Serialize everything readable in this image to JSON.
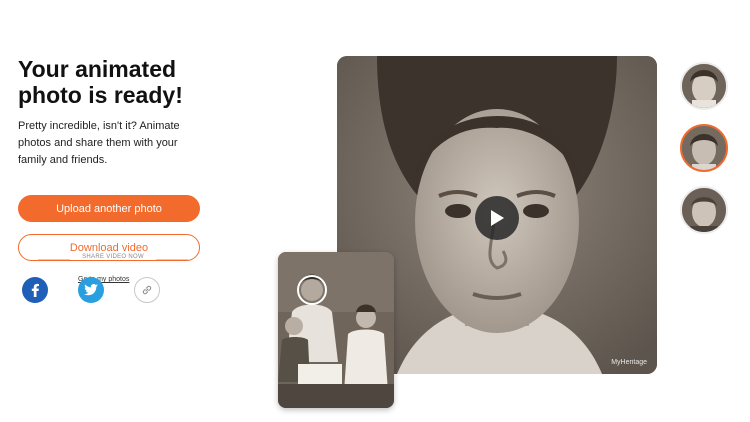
{
  "header": {
    "title_line1": "Your animated",
    "title_line2": "photo is ready!",
    "description": "Pretty incredible, isn't it? Animate photos and share them with your family and friends."
  },
  "actions": {
    "upload_label": "Upload another photo",
    "download_label": "Download video",
    "my_photos_link": "Go to my photos"
  },
  "share": {
    "label": "SHARE VIDEO NOW",
    "buttons": [
      {
        "name": "facebook",
        "icon": "facebook-icon",
        "color": "#1f5fb8"
      },
      {
        "name": "twitter",
        "icon": "twitter-icon",
        "color": "#2a9fe0"
      },
      {
        "name": "copy-link",
        "icon": "link-icon",
        "color": "#c8c8c8"
      }
    ]
  },
  "preview": {
    "watermark": "MyHeritage",
    "play_icon": "play-icon"
  },
  "colors": {
    "accent": "#f26b2d",
    "facebook": "#1f5fb8",
    "twitter": "#2a9fe0"
  }
}
